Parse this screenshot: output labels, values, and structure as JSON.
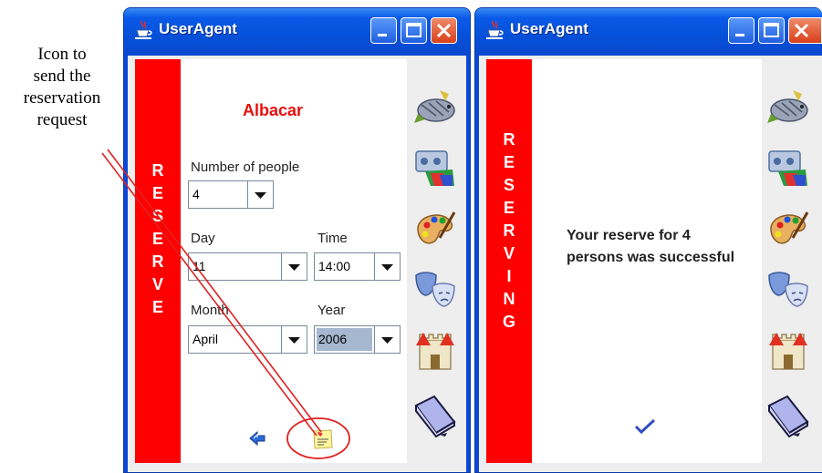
{
  "annotation": {
    "lines": [
      "Icon to",
      "send the",
      "reservation",
      "request"
    ]
  },
  "windows": [
    {
      "title": "UserAgent",
      "strip_word": [
        "R",
        "E",
        "S",
        "E",
        "R",
        "V",
        "E"
      ],
      "restaurant": "Albacar",
      "people_label": "Number of people",
      "people_value": "4",
      "day_label": "Day",
      "day_value": "11",
      "time_label": "Time",
      "time_value": "14:00",
      "month_label": "Month",
      "month_value": "April",
      "year_label": "Year",
      "year_value": "2006"
    },
    {
      "title": "UserAgent",
      "strip_word": [
        "R",
        "E",
        "S",
        "E",
        "R",
        "V",
        "I",
        "N",
        "G"
      ],
      "message": "Your reserve for 4 persons was successful"
    }
  ],
  "side_icons": [
    "fish-icon",
    "film-icon",
    "palette-icon",
    "theater-masks-icon",
    "castle-icon",
    "book-icon"
  ],
  "colors": {
    "strip": "#ff0000",
    "restaurant": "#e8100e",
    "titlebar": "#0a5ae8",
    "close": "#d8401a"
  }
}
